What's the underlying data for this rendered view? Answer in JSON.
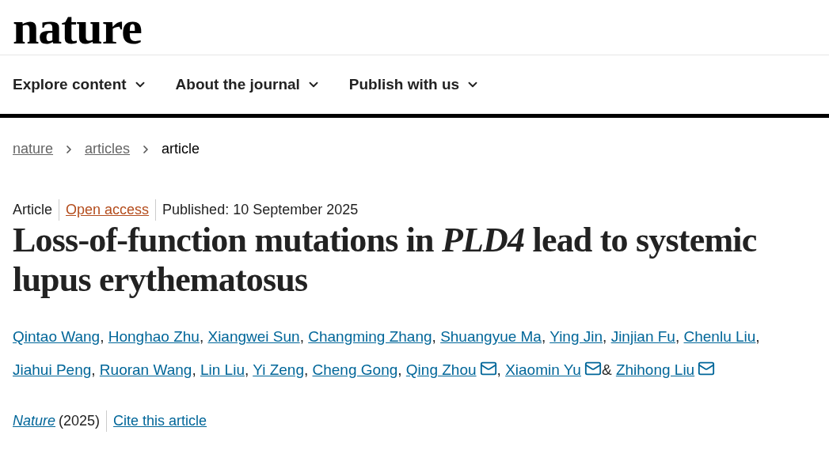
{
  "logo": "nature",
  "nav": [
    {
      "label": "Explore content"
    },
    {
      "label": "About the journal"
    },
    {
      "label": "Publish with us"
    }
  ],
  "breadcrumb": [
    {
      "label": "nature",
      "link": true
    },
    {
      "label": "articles",
      "link": true
    },
    {
      "label": "article",
      "link": false
    }
  ],
  "meta": {
    "type": "Article",
    "access": "Open access",
    "published": "Published: 10 September 2025"
  },
  "title": "Loss-of-function mutations in *PLD4* lead to systemic lupus erythematosus",
  "authors": [
    {
      "name": "Qintao Wang",
      "email": false,
      "sep": ","
    },
    {
      "name": "Honghao Zhu",
      "email": false,
      "sep": ","
    },
    {
      "name": "Xiangwei Sun",
      "email": false,
      "sep": ","
    },
    {
      "name": "Changming Zhang",
      "email": false,
      "sep": ","
    },
    {
      "name": "Shuangyue Ma",
      "email": false,
      "sep": ","
    },
    {
      "name": "Ying Jin",
      "email": false,
      "sep": ","
    },
    {
      "name": "Jinjian Fu",
      "email": false,
      "sep": ","
    },
    {
      "name": "Chenlu Liu",
      "email": false,
      "sep": ","
    },
    {
      "name": "Jiahui Peng",
      "email": false,
      "sep": ","
    },
    {
      "name": "Ruoran Wang",
      "email": false,
      "sep": ","
    },
    {
      "name": "Lin Liu",
      "email": false,
      "sep": ","
    },
    {
      "name": "Yi Zeng",
      "email": false,
      "sep": ","
    },
    {
      "name": "Cheng Gong",
      "email": false,
      "sep": ","
    },
    {
      "name": "Qing Zhou",
      "email": true,
      "sep": ","
    },
    {
      "name": "Xiaomin Yu",
      "email": true,
      "sep": "&"
    },
    {
      "name": "Zhihong Liu",
      "email": true
    }
  ],
  "citation": {
    "journal": "Nature",
    "year": "(2025)",
    "cite": "Cite this article"
  }
}
